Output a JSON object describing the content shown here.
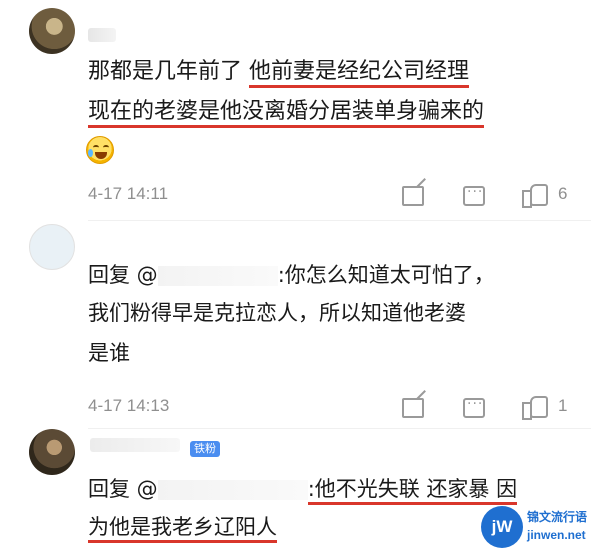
{
  "comments": [
    {
      "line1_plain": "那都是几年前了 ",
      "line1_underlined": "他前妻是经纪公司经理",
      "line2_underlined": "现在的老婆是他没离婚分居装单身骗来的",
      "emoji": "laugh-cry-emoji",
      "timestamp": "4-17 14:11",
      "likes": "6"
    },
    {
      "reply_prefix": "回复 @",
      "reply_rest": ":你怎么知道太可怕了，",
      "line2": "我们粉得早是克拉恋人，所以知道他老婆",
      "line3": "是谁",
      "timestamp": "4-17 14:13",
      "likes": "1"
    },
    {
      "badge": "铁粉",
      "reply_prefix": "回复 @",
      "reply_underlined": ":他不光失联 还家暴 因",
      "line2_underlined": "为他是我老乡辽阳人"
    }
  ],
  "watermark": {
    "logo": "jW",
    "name": "锦文流行语",
    "site": "jinwen.net"
  },
  "colors": {
    "underline": "#d9362b",
    "badge": "#4a8df0",
    "meta": "#8f8f8f"
  }
}
